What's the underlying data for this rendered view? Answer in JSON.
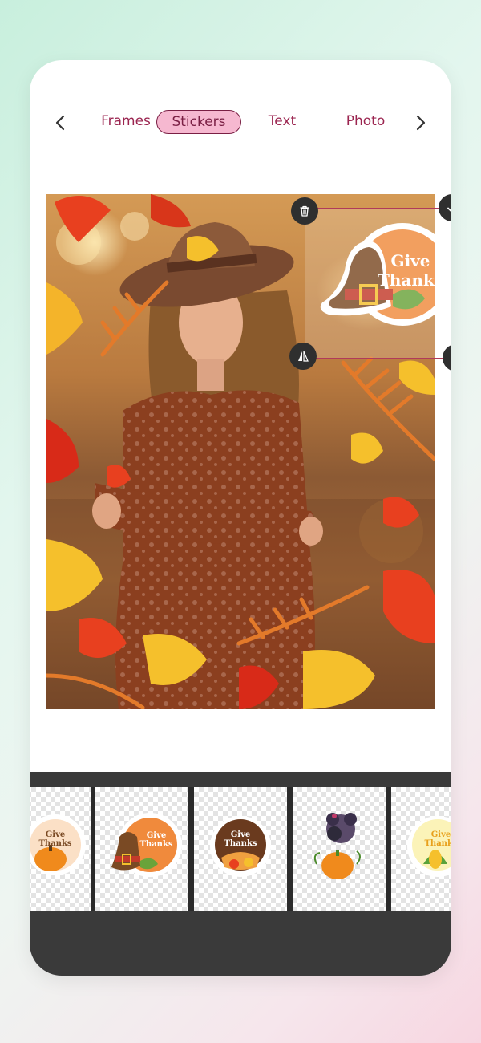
{
  "nav": {
    "tabs": [
      {
        "label": "Frames",
        "active": false
      },
      {
        "label": "Stickers",
        "active": true
      },
      {
        "label": "Text",
        "active": false
      },
      {
        "label": "Photo",
        "active": false
      }
    ],
    "prev_icon": "chevron-left-icon",
    "next_icon": "chevron-right-icon"
  },
  "canvas": {
    "sticker": {
      "line1": "Give",
      "line2": "Thanks"
    },
    "controls": {
      "delete_icon": "trash-icon",
      "confirm_icon": "check-icon",
      "flip_icon": "flip-icon",
      "resize_icon": "resize-icon"
    }
  },
  "stickers": [
    {
      "line1": "Give",
      "line2": "Thanks",
      "theme": "pumpkin"
    },
    {
      "line1": "Give",
      "line2": "Thanks",
      "theme": "pilgrim-hat"
    },
    {
      "line1": "Give",
      "line2": "Thanks",
      "theme": "pie"
    },
    {
      "line1": "",
      "line2": "",
      "theme": "turkey"
    },
    {
      "line1": "Give",
      "line2": "Thanks",
      "theme": "corn"
    }
  ],
  "colors": {
    "accent": "#9b2550",
    "active_tab_bg": "#f6b8d0",
    "tray_bg": "#3a3a3a",
    "sticker_orange": "#f08a3c"
  }
}
